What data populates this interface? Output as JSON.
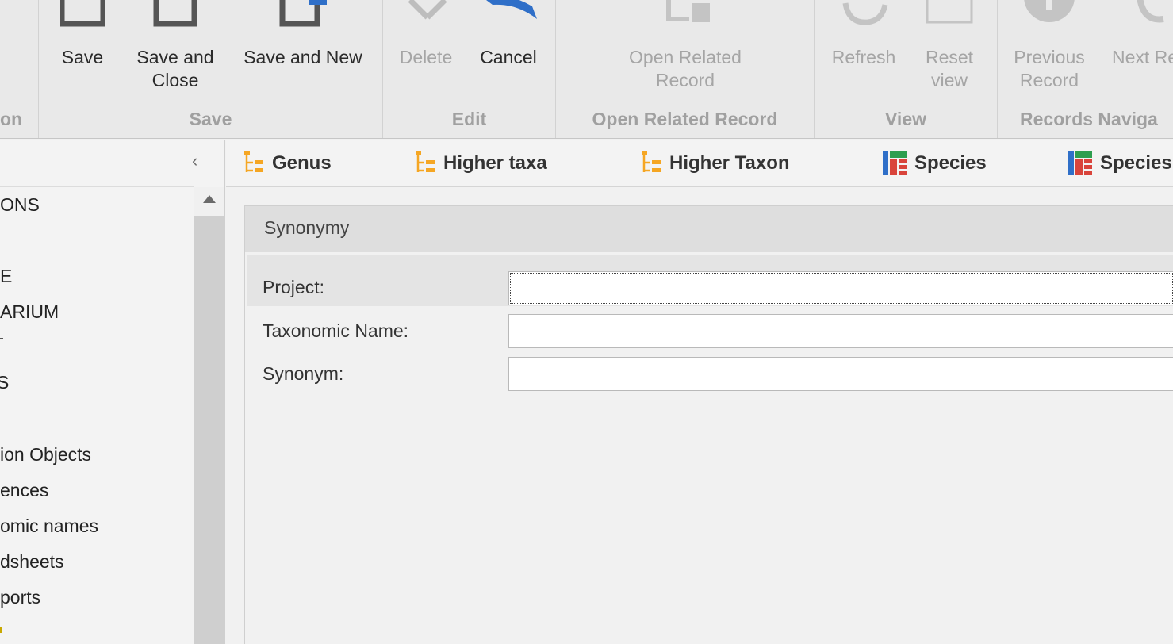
{
  "ribbon": {
    "groups": [
      {
        "title": "on"
      },
      {
        "title": "Save",
        "buttons": [
          {
            "label": "Save"
          },
          {
            "label": "Save and\nClose"
          },
          {
            "label": "Save and New"
          }
        ]
      },
      {
        "title": "Edit",
        "buttons": [
          {
            "label": "Delete"
          },
          {
            "label": "Cancel"
          }
        ]
      },
      {
        "title": "Open Related Record",
        "buttons": [
          {
            "label": "Open Related\nRecord"
          }
        ]
      },
      {
        "title": "View",
        "buttons": [
          {
            "label": "Refresh"
          },
          {
            "label": "Reset\nview"
          }
        ]
      },
      {
        "title": "Records Naviga",
        "buttons": [
          {
            "label": "Previous\nRecord"
          },
          {
            "label": "Next Re"
          }
        ]
      }
    ]
  },
  "nav": {
    "items": [
      "ONS",
      "E",
      "ARIUM",
      "S",
      "ion Objects",
      "ences",
      "omic names",
      "dsheets",
      "ports"
    ]
  },
  "tabs": [
    {
      "label": "Genus",
      "icon": "taxonomy-tree-icon"
    },
    {
      "label": "Higher taxa",
      "icon": "taxonomy-tree-icon"
    },
    {
      "label": "Higher Taxon",
      "icon": "taxonomy-tree-icon"
    },
    {
      "label": "Species",
      "icon": "species-grid-icon"
    },
    {
      "label": "Species",
      "icon": "species-grid-icon"
    }
  ],
  "form": {
    "title": "Synonymy",
    "fields": [
      {
        "label": "Project:",
        "value": ""
      },
      {
        "label": "Taxonomic Name:",
        "value": ""
      },
      {
        "label": "Synonym:",
        "value": ""
      }
    ]
  },
  "colors": {
    "accent_blue": "#2f6fc8",
    "tree_orange": "#f5a623",
    "disabled_gray": "#a5a5a5"
  }
}
